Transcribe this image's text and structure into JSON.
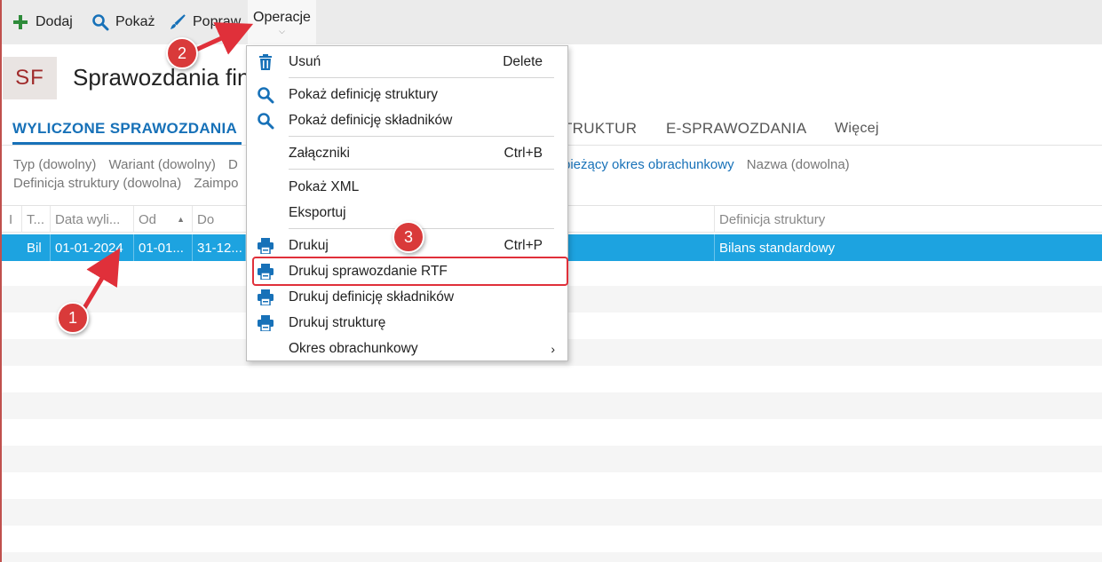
{
  "toolbar": {
    "add_label": "Dodaj",
    "show_label": "Pokaż",
    "edit_label": "Popraw",
    "operations_label": "Operacje",
    "operations_chevron": "⌵"
  },
  "header": {
    "badge": "SF",
    "title": "Sprawozdania fin"
  },
  "tabs": {
    "active": "WYLICZONE SPRAWOZDANIA",
    "struktur": "TRUKTUR",
    "e_spraw": "E-SPRAWOZDANIA",
    "more": "Więcej"
  },
  "filters": {
    "row1": [
      "Typ (dowolny)",
      "Wariant (dowolny)",
      "D"
    ],
    "row1_link": "bieżący okres obrachunkowy",
    "row1_after": "Nazwa (dowolna)",
    "row2": [
      "Definicja struktury (dowolna)",
      "Zaimpo"
    ]
  },
  "grid": {
    "headers": {
      "c0": "I",
      "c1": "T...",
      "c2": "Data wyli...",
      "c3": "Od",
      "c4": "Do",
      "c5": "Definicja struktury"
    },
    "selected_row": {
      "type": "Bil",
      "date": "01-01-2024",
      "from": "01-01...",
      "to": "31-12...",
      "definition": "Bilans standardowy"
    }
  },
  "menu": {
    "items": [
      {
        "label": "Usuń",
        "shortcut": "Delete",
        "icon": "trash-icon"
      },
      {
        "label": "Pokaż definicję struktury",
        "shortcut": "",
        "icon": "search-icon"
      },
      {
        "label": "Pokaż definicję składników",
        "shortcut": "",
        "icon": "search-icon"
      },
      {
        "label": "Załączniki",
        "shortcut": "Ctrl+B",
        "icon": ""
      },
      {
        "label": "Pokaż XML",
        "shortcut": "",
        "icon": ""
      },
      {
        "label": "Eksportuj",
        "shortcut": "",
        "icon": ""
      },
      {
        "label": "Drukuj",
        "shortcut": "Ctrl+P",
        "icon": "printer-icon"
      },
      {
        "label": "Drukuj sprawozdanie RTF",
        "shortcut": "",
        "icon": "printer-icon"
      },
      {
        "label": "Drukuj definicję składników",
        "shortcut": "",
        "icon": "printer-icon"
      },
      {
        "label": "Drukuj strukturę",
        "shortcut": "",
        "icon": "printer-icon"
      },
      {
        "label": "Okres obrachunkowy",
        "shortcut": "",
        "icon": "",
        "submenu_arrow": "›"
      }
    ]
  },
  "annotations": {
    "step1": "1",
    "step2": "2",
    "step3": "3"
  },
  "colors": {
    "accent": "#1771b8",
    "selection": "#1da3e0",
    "annotation": "#d93a3a",
    "add_icon": "#2e8b3a"
  }
}
